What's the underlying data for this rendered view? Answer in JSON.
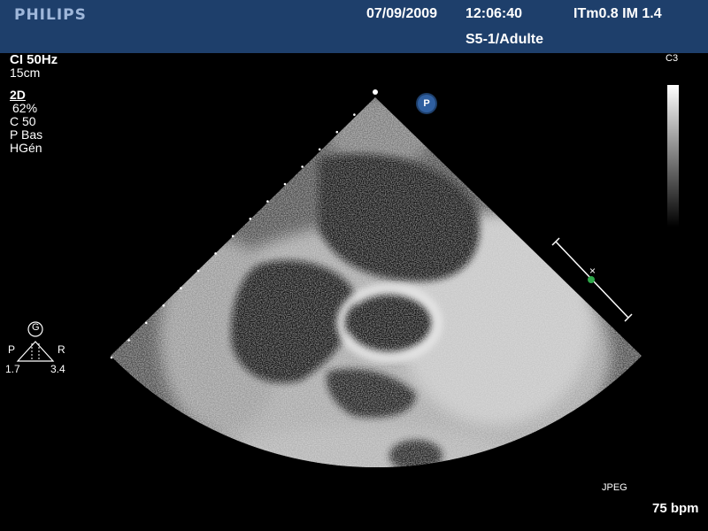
{
  "header": {
    "brand": "PHILIPS",
    "date": "07/09/2009",
    "time": "12:06:40",
    "indices": "ITm0.8  IM 1.4",
    "probe_preset": "S5-1/Adulte"
  },
  "settings": {
    "color_frequency": "CI 50Hz",
    "depth": "15cm",
    "mode": "2D",
    "gain": "62%",
    "compression": "C 50",
    "power": "P Bas",
    "harmonic": "HGén"
  },
  "colormap": {
    "label": "C3"
  },
  "probe_marker": {
    "label": "P"
  },
  "orientation": {
    "center_label": "G",
    "left_label": "P",
    "right_label": "R",
    "left_value": "1.7",
    "right_value": "3.4"
  },
  "footer": {
    "format": "JPEG",
    "heart_rate": "75 bpm"
  },
  "colors": {
    "header_bg": "#1e3f6b",
    "brand_text": "#9fb7da",
    "probe_marker": "#2f5fa0",
    "focus_marker": "#2ea84a"
  },
  "icons": {
    "probe_marker": "circle-p-icon",
    "orientation": "triangle-icon",
    "depth_scale": "dotted-scale-icon",
    "focus": "x-marker-icon"
  }
}
